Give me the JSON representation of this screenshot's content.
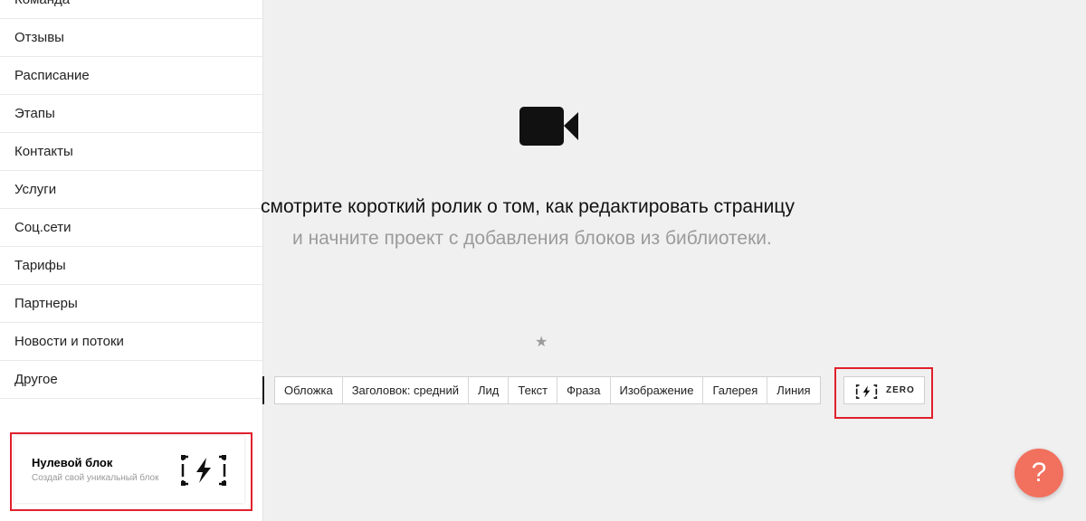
{
  "sidebar": {
    "items": [
      {
        "label": "Команда"
      },
      {
        "label": "Отзывы"
      },
      {
        "label": "Расписание"
      },
      {
        "label": "Этапы"
      },
      {
        "label": "Контакты"
      },
      {
        "label": "Услуги"
      },
      {
        "label": "Соц.сети"
      },
      {
        "label": "Тарифы"
      },
      {
        "label": "Партнеры"
      },
      {
        "label": "Новости и потоки"
      },
      {
        "label": "Другое"
      }
    ],
    "zero_card": {
      "title": "Нулевой блок",
      "subtitle": "Создай свой уникальный блок",
      "icon": "zero-block-icon"
    }
  },
  "main": {
    "video_icon": "video-camera-icon",
    "headline": "смотрите короткий ролик о том, как редактировать страницу",
    "subline": "и начните проект с добавления блоков из библиотеки.",
    "star_icon": "star-icon",
    "star_glyph": "★"
  },
  "toolbar": {
    "buttons": [
      {
        "label": "Обложка"
      },
      {
        "label": "Заголовок: средний"
      },
      {
        "label": "Лид"
      },
      {
        "label": "Текст"
      },
      {
        "label": "Фраза"
      },
      {
        "label": "Изображение"
      },
      {
        "label": "Галерея"
      },
      {
        "label": "Линия"
      }
    ],
    "zero_button": {
      "label": "ZERO",
      "icon": "zero-block-icon"
    }
  },
  "help_button": {
    "label": "?"
  },
  "colors": {
    "highlight": "#e0202c",
    "help_button": "#f2705e",
    "background": "#f0f0f0",
    "muted_text": "#9b9b9b"
  }
}
